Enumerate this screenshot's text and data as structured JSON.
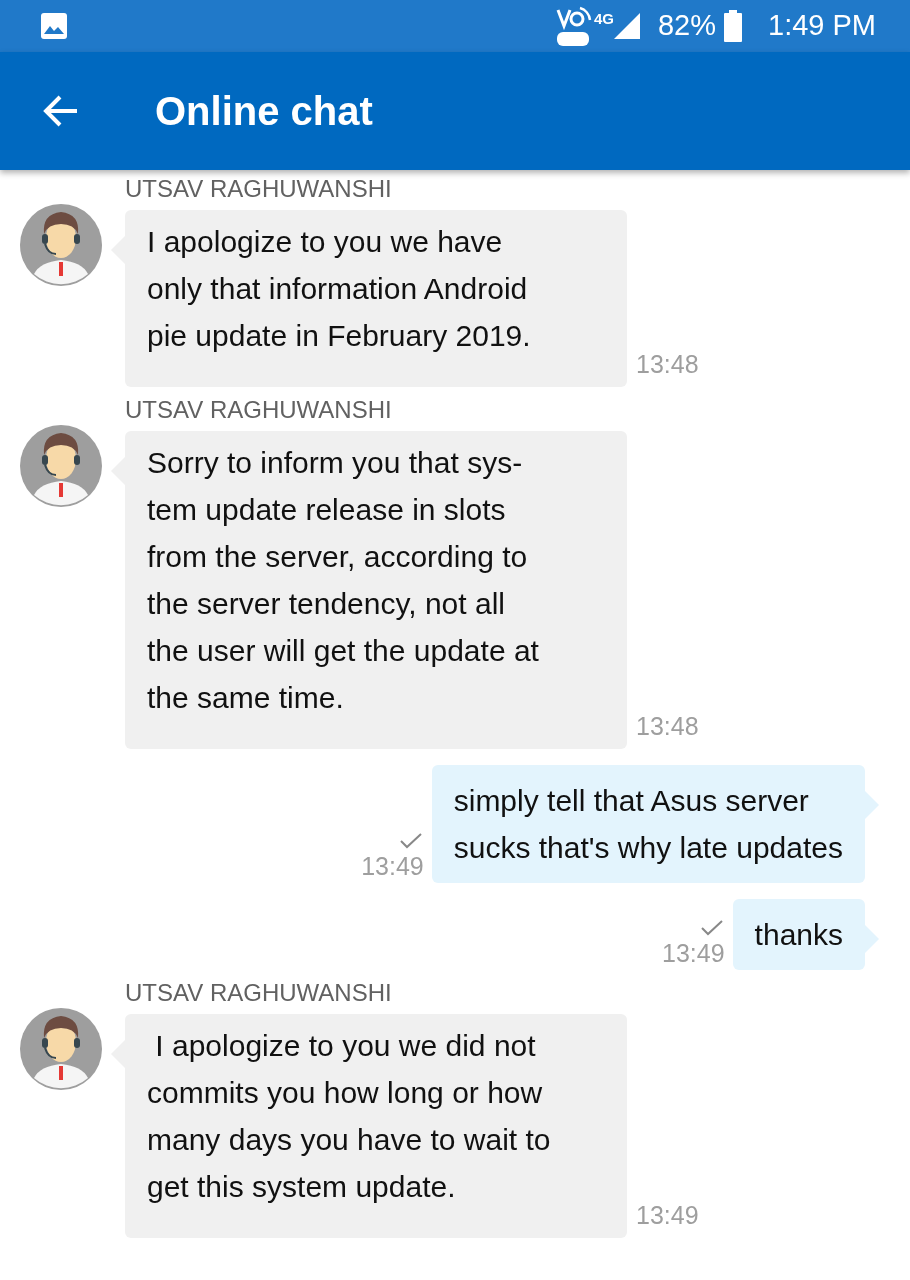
{
  "status_bar": {
    "network": "4G",
    "battery": "82%",
    "time": "1:49 PM"
  },
  "header": {
    "title": "Online chat"
  },
  "messages": [
    {
      "kind": "agent",
      "sender": "UTSAV RAGHUWANSHI",
      "text": "I apologize to you we have\nonly that information Android\npie update in February 2019.",
      "time": "13:48"
    },
    {
      "kind": "agent",
      "sender": "UTSAV RAGHUWANSHI",
      "text": "Sorry to inform you that sys-\ntem update release in slots\nfrom the server, according to\nthe server tendency, not all\nthe user will get the update at\nthe same time.",
      "time": "13:48"
    },
    {
      "kind": "user",
      "text": "simply tell that Asus server\nsucks that's why late updates",
      "time": "13:49",
      "sent": true
    },
    {
      "kind": "user",
      "text": "thanks",
      "time": "13:49",
      "sent": true
    },
    {
      "kind": "agent",
      "sender": "UTSAV RAGHUWANSHI",
      "text": " I apologize to you we did not\ncommits you how long or how\nmany days you have to wait to\nget this system update.",
      "time": "13:49"
    }
  ]
}
